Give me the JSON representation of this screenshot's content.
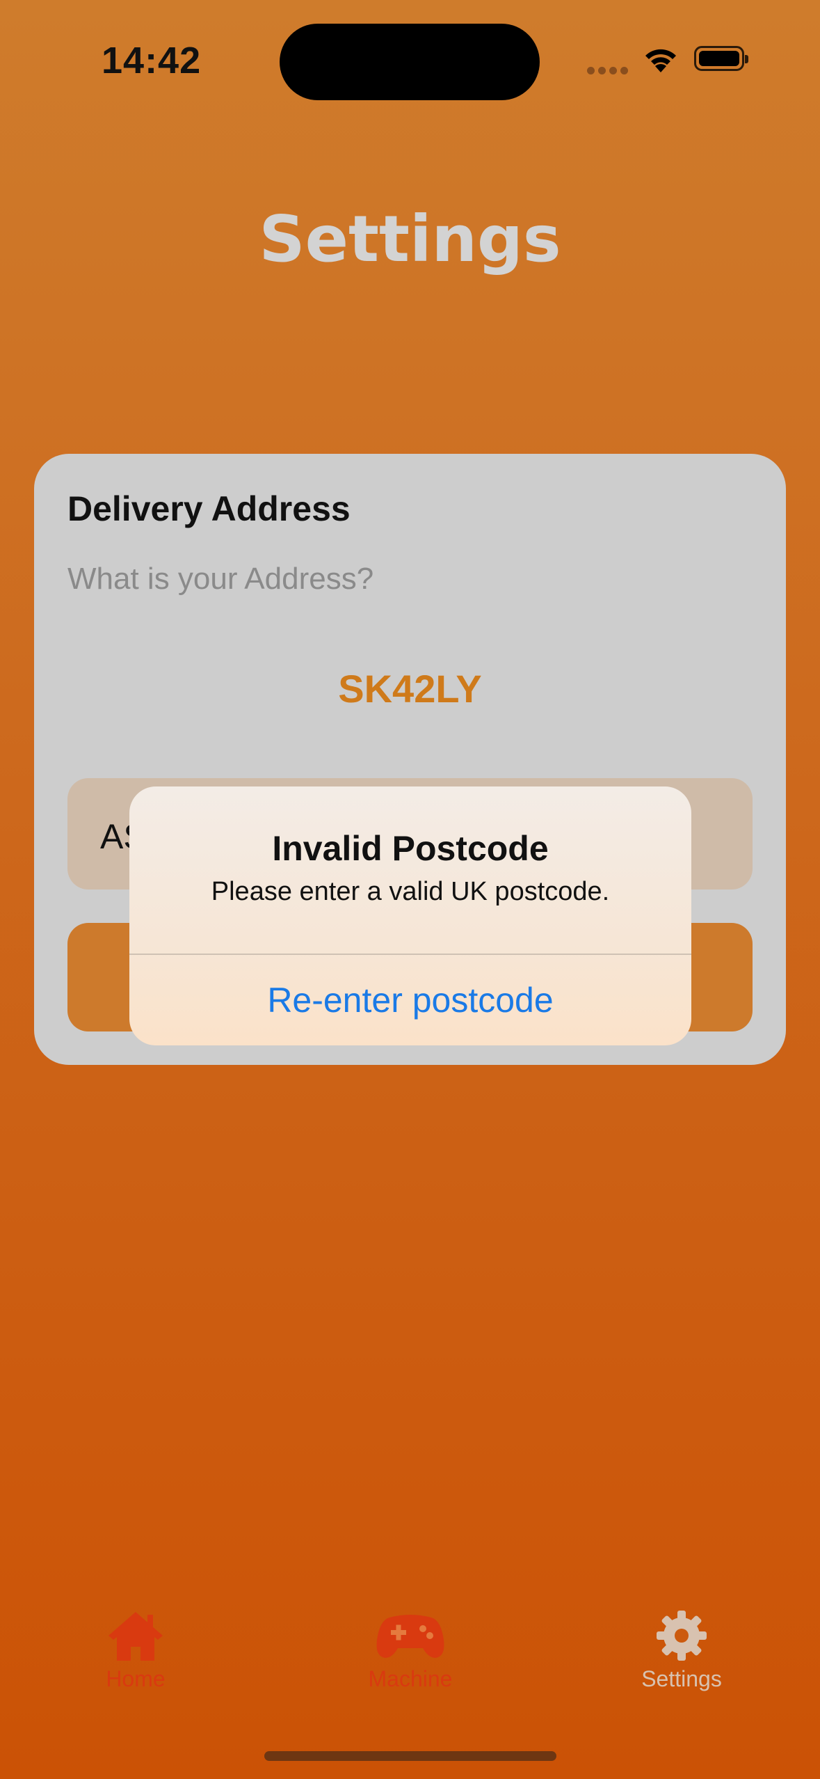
{
  "status_bar": {
    "time": "14:42"
  },
  "page": {
    "title": "Settings"
  },
  "card": {
    "heading": "Delivery Address",
    "question": "What is your Address?",
    "postcode": "SK42LY",
    "address_field_value": "AS"
  },
  "alert": {
    "title": "Invalid Postcode",
    "message": "Please enter a valid UK postcode.",
    "button": "Re-enter postcode"
  },
  "tabbar": {
    "items": [
      {
        "label": "Home",
        "icon": "house-icon",
        "selected": false
      },
      {
        "label": "Machine",
        "icon": "gamecontroller-icon",
        "selected": false
      },
      {
        "label": "Settings",
        "icon": "gear-icon",
        "selected": true
      }
    ]
  },
  "colors": {
    "background_top": "#cf7c2c",
    "background_bottom": "#cb5205",
    "accent_orange": "#cf7a1a",
    "link_blue": "#1a7ae6",
    "tab_active_red": "#d93a10"
  }
}
